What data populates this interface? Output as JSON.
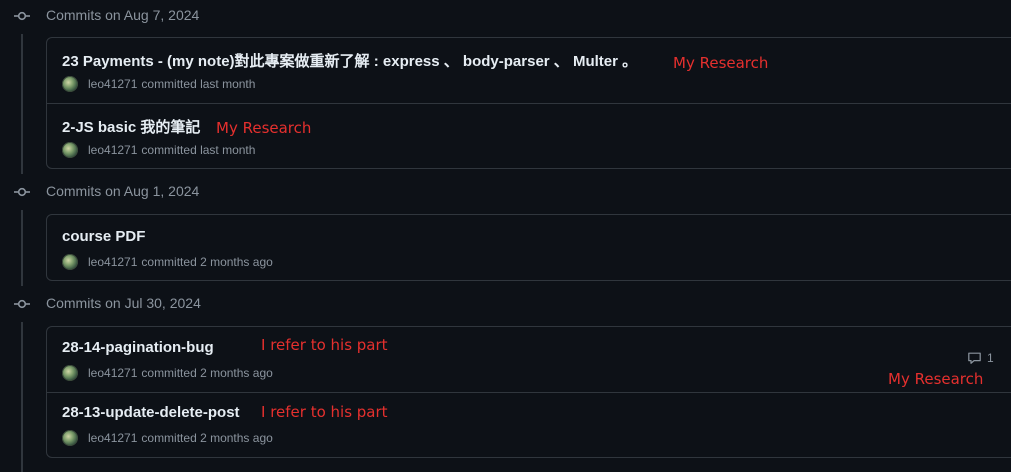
{
  "colors": {
    "background": "#0d1117",
    "border": "#30363d",
    "muted_text": "#8b949e",
    "primary_text": "#e6edf3",
    "annotation_red": "#e5302e"
  },
  "groups": [
    {
      "title": "Commits on Aug 7, 2024",
      "commits": [
        {
          "message": "23 Payments - (my note)對此專案做重新了解 : express 、 body-parser 、 Multer 。",
          "author": "leo41271",
          "action_time": "committed last month",
          "annotation": "My Research"
        },
        {
          "message": "2-JS basic 我的筆記",
          "author": "leo41271",
          "action_time": "committed last month",
          "annotation": "My Research"
        }
      ]
    },
    {
      "title": "Commits on Aug 1, 2024",
      "commits": [
        {
          "message": "course PDF",
          "author": "leo41271",
          "action_time": "committed 2 months ago"
        }
      ]
    },
    {
      "title": "Commits on Jul 30, 2024",
      "commits": [
        {
          "message": "28-14-pagination-bug",
          "author": "leo41271",
          "action_time": "committed 2 months ago",
          "annotation": "I refer to his part",
          "comment_count": "1",
          "side_annotation": "My Research"
        },
        {
          "message": "28-13-update-delete-post",
          "author": "leo41271",
          "action_time": "committed 2 months ago",
          "annotation": "I refer to his part"
        }
      ]
    }
  ]
}
